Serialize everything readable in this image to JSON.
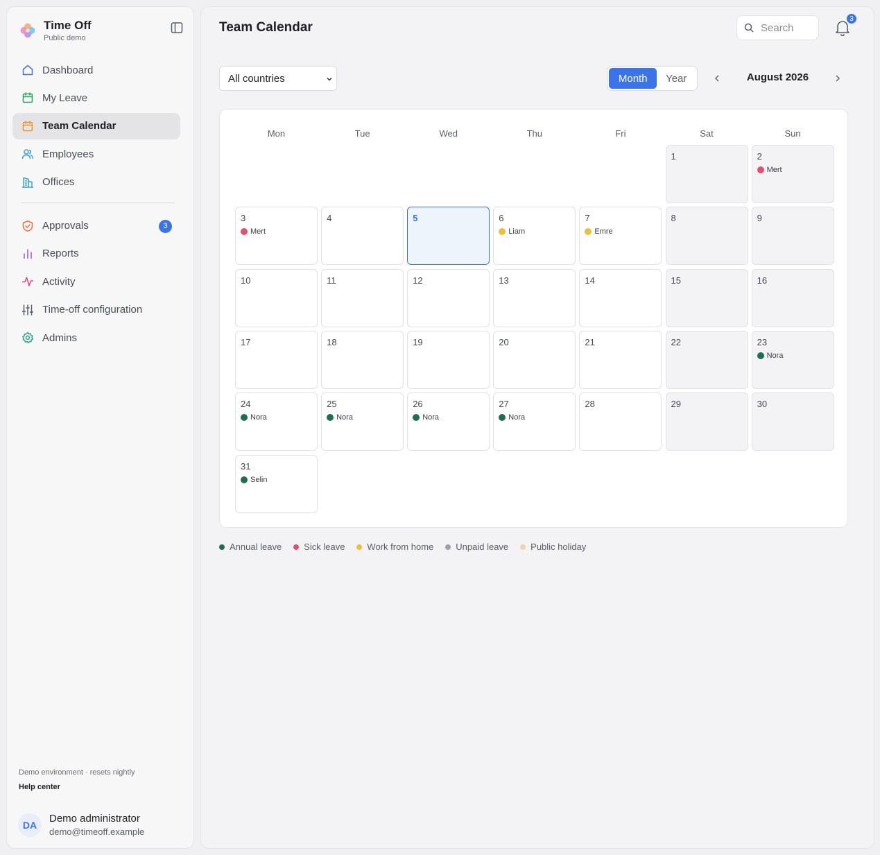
{
  "brand": {
    "title": "Time Off",
    "subtitle": "Public demo"
  },
  "sidebar": {
    "items": [
      {
        "label": "Dashboard",
        "icon": "home-icon",
        "color": "#3b74e8"
      },
      {
        "label": "My Leave",
        "icon": "calendar-icon",
        "color": "#22a35a"
      },
      {
        "label": "Team Calendar",
        "icon": "calendar-icon",
        "color": "#f0932b",
        "active": true
      },
      {
        "label": "Employees",
        "icon": "users-icon",
        "color": "#3aa0d8"
      },
      {
        "label": "Offices",
        "icon": "building-icon",
        "color": "#3aa0d8"
      }
    ],
    "items2": [
      {
        "label": "Approvals",
        "icon": "shield-check-icon",
        "color": "#f06a3a",
        "badge": "3"
      },
      {
        "label": "Reports",
        "icon": "bar-chart-icon",
        "color": "#9b59d0"
      },
      {
        "label": "Activity",
        "icon": "activity-icon",
        "color": "#e8457a"
      },
      {
        "label": "Time-off configuration",
        "icon": "sliders-icon",
        "color": "#5b5e66"
      },
      {
        "label": "Admins",
        "icon": "gear-icon",
        "color": "#2aa58a"
      }
    ],
    "footer_env": "Demo environment · resets nightly",
    "help_center": "Help center",
    "user": {
      "initials": "DA",
      "name": "Demo administrator",
      "email": "demo@timeoff.example"
    }
  },
  "header": {
    "title": "Team Calendar",
    "search_placeholder": "Search",
    "notifications": "3"
  },
  "filters": {
    "country": "All countries",
    "view_options": [
      "Month",
      "Year"
    ],
    "selected_view": "Month",
    "period": "August 2026"
  },
  "calendar": {
    "weekdays": [
      "Mon",
      "Tue",
      "Wed",
      "Thu",
      "Fri",
      "Sat",
      "Sun"
    ],
    "first_weekday_index": 5,
    "days_in_month": 31,
    "today": 5,
    "events": [
      {
        "day": 2,
        "name": "Mert",
        "type": "Sick leave"
      },
      {
        "day": 3,
        "name": "Mert",
        "type": "Sick leave"
      },
      {
        "day": 6,
        "name": "Liam",
        "type": "Work from home"
      },
      {
        "day": 7,
        "name": "Emre",
        "type": "Work from home"
      },
      {
        "day": 23,
        "name": "Nora",
        "type": "Annual leave"
      },
      {
        "day": 24,
        "name": "Nora",
        "type": "Annual leave"
      },
      {
        "day": 25,
        "name": "Nora",
        "type": "Annual leave"
      },
      {
        "day": 26,
        "name": "Nora",
        "type": "Annual leave"
      },
      {
        "day": 27,
        "name": "Nora",
        "type": "Annual leave"
      },
      {
        "day": 31,
        "name": "Selin",
        "type": "Annual leave"
      }
    ]
  },
  "legend": [
    {
      "label": "Annual leave",
      "color": "#1e6e50"
    },
    {
      "label": "Sick leave",
      "color": "#e2506e"
    },
    {
      "label": "Work from home",
      "color": "#ecc03a"
    },
    {
      "label": "Unpaid leave",
      "color": "#9ca0a8"
    },
    {
      "label": "Public holiday",
      "color": "#f5d3a8"
    }
  ]
}
